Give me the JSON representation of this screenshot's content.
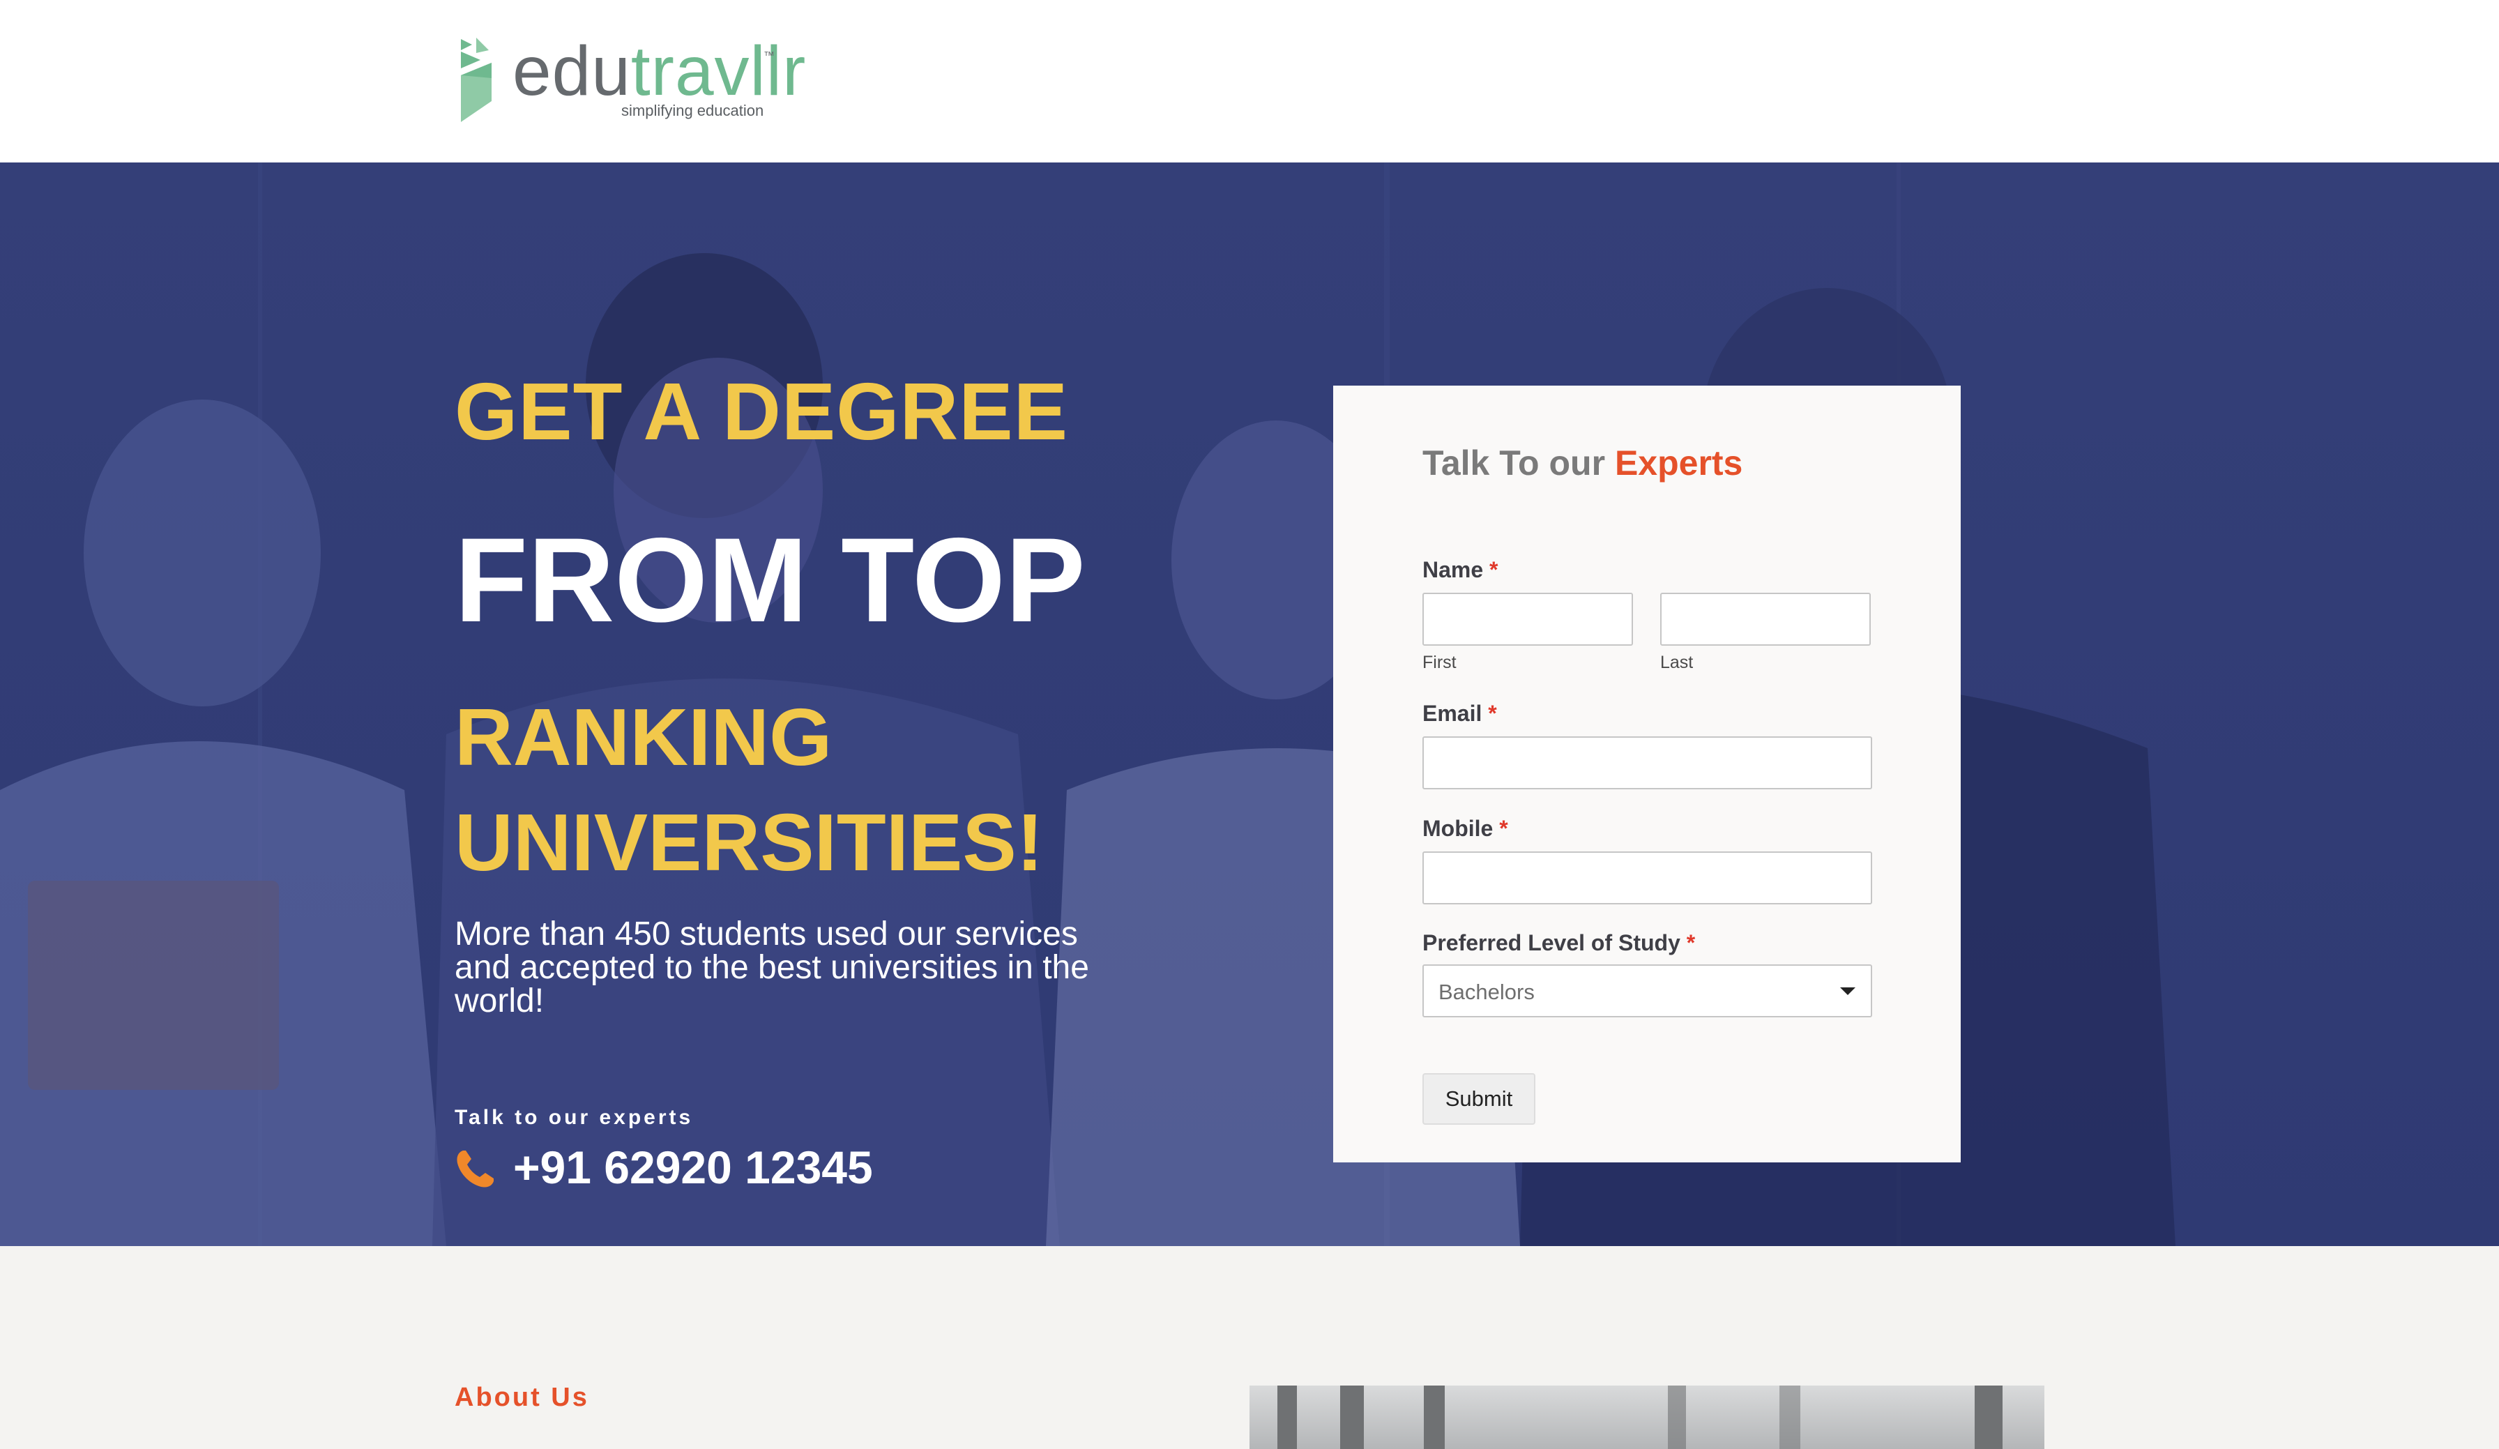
{
  "header": {
    "logo": {
      "word_part1": "edu",
      "word_part2": "travllr",
      "trademark": "™",
      "tagline": "simplifying education",
      "color_gray": "#666a6e",
      "color_green": "#6fb98f"
    }
  },
  "hero": {
    "line1": "GET A DEGREE",
    "line2": "FROM TOP",
    "line3": "RANKING",
    "line4": "UNIVERSITIES!",
    "subtext": "More than 450 students used our services and accepted to the best universities in the world!",
    "talk_label": "Talk to our experts",
    "phone": "+91 62920 12345",
    "phone_icon": "phone-icon",
    "color_yellow": "#f2c84b",
    "color_overlay": "#343f78"
  },
  "form": {
    "title_part1": "Talk To our ",
    "title_part2": "Experts",
    "accent_color": "#e5512a",
    "required_mark": "*",
    "name_label": "Name",
    "first_sublabel": "First",
    "last_sublabel": "Last",
    "first_value": "",
    "last_value": "",
    "email_label": "Email",
    "email_value": "",
    "mobile_label": "Mobile",
    "mobile_value": "",
    "level_label": "Preferred Level of Study",
    "level_selected": "Bachelors",
    "submit_label": "Submit"
  },
  "about": {
    "title": "About Us"
  }
}
